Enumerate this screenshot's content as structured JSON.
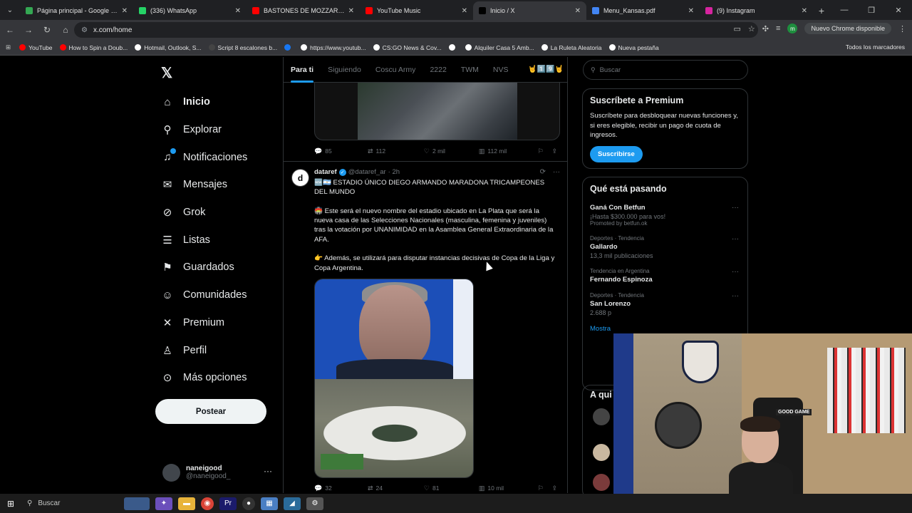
{
  "browser": {
    "tabs": [
      {
        "title": "Página principal - Google Drive",
        "color": "#34a853"
      },
      {
        "title": "(336) WhatsApp",
        "color": "#25d366"
      },
      {
        "title": "BASTONES DE MOZZARELL",
        "color": "#ff0000"
      },
      {
        "title": "YouTube Music",
        "color": "#ff0000"
      },
      {
        "title": "Inicio / X",
        "color": "#000000"
      },
      {
        "title": "Menu_Kansas.pdf",
        "color": "#4285f4"
      },
      {
        "title": "(9) Instagram",
        "color": "#d6249f"
      }
    ],
    "url": "x.com/home",
    "update_label": "Nuevo Chrome disponible",
    "profile_initial": "m",
    "bookmarks": [
      {
        "label": "YouTube",
        "color": "#ff0000"
      },
      {
        "label": "How to Spin a Doub...",
        "color": "#ff0000"
      },
      {
        "label": "Hotmail, Outlook, S...",
        "color": "#ffffff"
      },
      {
        "label": "Script 8 escalones b...",
        "color": "#444444"
      },
      {
        "label": "",
        "color": "#1877f2"
      },
      {
        "label": "https://www.youtub...",
        "color": "#ffffff"
      },
      {
        "label": "CS:GO News & Cov...",
        "color": "#ffffff"
      },
      {
        "label": "",
        "color": "#ffffff"
      },
      {
        "label": "Alquiler Casa 5 Amb...",
        "color": "#ffffff"
      },
      {
        "label": "La Ruleta Aleatoria",
        "color": "#ffffff"
      },
      {
        "label": "Nueva pestaña",
        "color": "#ffffff"
      }
    ],
    "all_bookmarks": "Todos los marcadores"
  },
  "nav": {
    "items": [
      {
        "label": "Inicio",
        "icon": "home-icon",
        "glyph": "⌂"
      },
      {
        "label": "Explorar",
        "icon": "search-icon",
        "glyph": "⚲"
      },
      {
        "label": "Notificaciones",
        "icon": "bell-icon",
        "glyph": "♫"
      },
      {
        "label": "Mensajes",
        "icon": "mail-icon",
        "glyph": "✉"
      },
      {
        "label": "Grok",
        "icon": "grok-icon",
        "glyph": "⊘"
      },
      {
        "label": "Listas",
        "icon": "list-icon",
        "glyph": "☰"
      },
      {
        "label": "Guardados",
        "icon": "bookmark-icon",
        "glyph": "⚑"
      },
      {
        "label": "Comunidades",
        "icon": "communities-icon",
        "glyph": "☺"
      },
      {
        "label": "Premium",
        "icon": "x-icon",
        "glyph": "✕"
      },
      {
        "label": "Perfil",
        "icon": "profile-icon",
        "glyph": "♙"
      },
      {
        "label": "Más opciones",
        "icon": "more-icon",
        "glyph": "⊙"
      }
    ],
    "post_button": "Postear",
    "account": {
      "name": "naneigood",
      "handle": "@naneigood_"
    }
  },
  "timeline": {
    "tabs": [
      "Para ti",
      "Siguiendo",
      "Coscu Army",
      "2222",
      "TWM",
      "NVS"
    ],
    "tab_extra": "🤘1️⃣9️⃣🤘",
    "prev_actions": {
      "replies": "85",
      "reposts": "112",
      "likes": "2 mil",
      "views": "112 mil"
    },
    "post": {
      "author": "dataref",
      "handle": "@dataref_ar",
      "time": "· 2h",
      "avatar_letter": "d",
      "lines": [
        "🆕🇦🇷 ESTADIO ÚNICO DIEGO ARMANDO MARADONA TRICAMPEONES DEL MUNDO",
        "🏟️ Este será el nuevo nombre del estadio ubicado en La Plata que será la nueva casa de las Selecciones Nacionales (masculina, femenina y juveniles) tras la votación por UNANIMIDAD en la Asamblea General Extraordinaria de la AFA.",
        "👉 Además, se utilizará para disputar instancias decisivas de Copa de la Liga y Copa Argentina."
      ],
      "actions": {
        "replies": "32",
        "reposts": "24",
        "likes": "81",
        "views": "10 mil"
      }
    }
  },
  "right": {
    "search_placeholder": "Buscar",
    "premium": {
      "title": "Suscríbete a Premium",
      "body": "Suscríbete para desbloquear nuevas funciones y, si eres elegible, recibir un pago de cuota de ingresos.",
      "button": "Suscribirse"
    },
    "trends": {
      "title": "Qué está pasando",
      "items": [
        {
          "ctx": "",
          "title": "Ganá Con Betfun",
          "sub": "¡Hasta $300.000 para vos!",
          "promo": "Promoted by betfun.ok"
        },
        {
          "ctx": "Deportes · Tendencia",
          "title": "Gallardo",
          "sub": "13,3 mil publicaciones",
          "promo": ""
        },
        {
          "ctx": "Tendencia en Argentina",
          "title": "Fernando Espinoza",
          "sub": "",
          "promo": ""
        },
        {
          "ctx": "Deportes · Tendencia",
          "title": "San Lorenzo",
          "sub": "2.688 p",
          "promo": ""
        }
      ],
      "show_more": "Mostra"
    },
    "who_to_follow": "A qui"
  },
  "webcam": {
    "sign": "GOOD GAME"
  },
  "taskbar": {
    "search": "Buscar"
  }
}
